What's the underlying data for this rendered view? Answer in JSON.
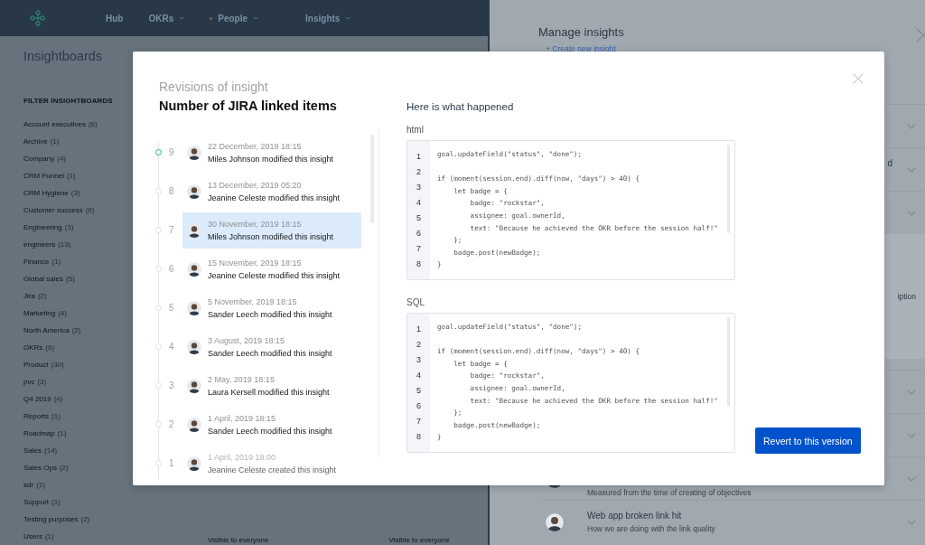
{
  "nav": {
    "items": [
      {
        "label": "Hub",
        "caret": false,
        "dot": false
      },
      {
        "label": "OKRs",
        "caret": true,
        "dot": false
      },
      {
        "label": "People",
        "caret": true,
        "dot": true
      },
      {
        "label": "Insights",
        "caret": true,
        "dot": false
      }
    ]
  },
  "sidebar": {
    "title": "Insightboards",
    "heading": "FILTER INSIGHTBOARDS",
    "items": [
      {
        "label": "Account executives",
        "count": "(6)"
      },
      {
        "label": "Archive",
        "count": "(1)"
      },
      {
        "label": "Company",
        "count": "(4)"
      },
      {
        "label": "CRM Funnel",
        "count": "(1)"
      },
      {
        "label": "CRM Hygiene",
        "count": "(3)"
      },
      {
        "label": "Customer success",
        "count": "(6)"
      },
      {
        "label": "Engineering",
        "count": "(3)"
      },
      {
        "label": "engineers",
        "count": "(13)"
      },
      {
        "label": "Finance",
        "count": "(1)"
      },
      {
        "label": "Global sales",
        "count": "(5)"
      },
      {
        "label": "Jira",
        "count": "(2)"
      },
      {
        "label": "Marketing",
        "count": "(4)"
      },
      {
        "label": "North America",
        "count": "(2)"
      },
      {
        "label": "OKRs",
        "count": "(6)"
      },
      {
        "label": "Product",
        "count": "(30)"
      },
      {
        "label": "pvc",
        "count": "(3)"
      },
      {
        "label": "Q4 2019",
        "count": "(4)"
      },
      {
        "label": "Reports",
        "count": "(1)"
      },
      {
        "label": "Roadmap",
        "count": "(1)"
      },
      {
        "label": "Sales",
        "count": "(14)"
      },
      {
        "label": "Sales Ops",
        "count": "(2)"
      },
      {
        "label": "sdr",
        "count": "(1)"
      },
      {
        "label": "Support",
        "count": "(1)"
      },
      {
        "label": "Testing purposes",
        "count": "(2)"
      },
      {
        "label": "Users",
        "count": "(1)"
      }
    ]
  },
  "boards": [
    {
      "visibility": "Visible to everyone"
    },
    {
      "visibility": "Visible to everyone"
    }
  ],
  "drawer": {
    "title": "Manage insights",
    "link": "+ Create new insight",
    "rows": [
      {
        "kind": "row"
      },
      {
        "kind": "row",
        "title": "d"
      },
      {
        "kind": "row"
      },
      {
        "kind": "card",
        "text": "iption"
      },
      {
        "kind": "row"
      },
      {
        "kind": "row"
      },
      {
        "kind": "row",
        "avatar": true,
        "subtitle": "Measured from the time of creating of objectives"
      },
      {
        "kind": "row",
        "avatar": true,
        "title": "Web app broken link hit",
        "subtitle": "How we are doing with the link quality"
      }
    ]
  },
  "modal": {
    "subtitle": "Revisions of insight",
    "title": "Number of JIRA linked items",
    "heading": "Here is what happened",
    "revisions": [
      {
        "number": "9",
        "date": "22 December, 2019 18:15",
        "text": "Miles Johnson modified this insight",
        "current": true,
        "selected": false
      },
      {
        "number": "8",
        "date": "13 December, 2019 05:20",
        "text": "Jeanine Celeste modified this insight",
        "current": false,
        "selected": false
      },
      {
        "number": "7",
        "date": "30 November, 2019 18:15",
        "text": "Miles Johnson modified this insight",
        "current": false,
        "selected": true
      },
      {
        "number": "6",
        "date": "15 November, 2019 18:15",
        "text": "Jeanine Celeste modified this insight",
        "current": false,
        "selected": false
      },
      {
        "number": "5",
        "date": "5 November, 2019 18:15",
        "text": "Sander Leech modified this insight",
        "current": false,
        "selected": false
      },
      {
        "number": "4",
        "date": "3 August, 2019 18:15",
        "text": "Sander Leech modified this insight",
        "current": false,
        "selected": false
      },
      {
        "number": "3",
        "date": "2 May, 2019 18:15",
        "text": "Laura Kersell modified this insight",
        "current": false,
        "selected": false
      },
      {
        "number": "2",
        "date": "1 April, 2019 18:15",
        "text": "Sander Leech modified this insight",
        "current": false,
        "selected": false
      },
      {
        "number": "1",
        "date": "1 April, 2019 18:00",
        "text": "Jeanine Celeste created this insight",
        "current": false,
        "selected": false
      }
    ],
    "code_blocks": [
      {
        "label": "html",
        "line_numbers": [
          "1",
          "2",
          "3",
          "4",
          "5",
          "6",
          "7",
          "8"
        ],
        "lines": [
          {
            "kind": "code",
            "text": "goal.updateField(\"status\", \"done\");"
          },
          {
            "kind": "blank"
          },
          {
            "kind": "code",
            "text": "if (moment(session.end).diff(now, \"days\") > 40) {"
          },
          {
            "kind": "code",
            "text": "    let badge = {"
          },
          {
            "kind": "code",
            "text": "        badge: \"rockstar\","
          },
          {
            "kind": "code",
            "text": "        assignee: goal.ownerId,"
          },
          {
            "kind": "code",
            "text": "        text: \"Because he achieved the OKR before the session half!\""
          },
          {
            "kind": "code",
            "text": "    };"
          },
          {
            "kind": "code",
            "text": "    badge.post(newBadge);"
          },
          {
            "kind": "code",
            "text": "}"
          }
        ]
      },
      {
        "label": "SQL",
        "line_numbers": [
          "1",
          "2",
          "3",
          "4",
          "5",
          "6",
          "7",
          "8"
        ],
        "lines": [
          {
            "kind": "code",
            "text": "goal.updateField(\"status\", \"done\");"
          },
          {
            "kind": "blank"
          },
          {
            "kind": "code",
            "text": "if (moment(session.end).diff(now, \"days\") > 40) {"
          },
          {
            "kind": "code",
            "text": "    let badge = {"
          },
          {
            "kind": "code",
            "text": "        badge: \"rockstar\","
          },
          {
            "kind": "code",
            "text": "        assignee: goal.ownerId,"
          },
          {
            "kind": "code",
            "text": "        text: \"Because he achieved the OKR before the session half!\""
          },
          {
            "kind": "code",
            "text": "    };"
          },
          {
            "kind": "code",
            "text": "    badge.post(newBadge);"
          },
          {
            "kind": "code",
            "text": "}"
          }
        ]
      }
    ],
    "button": "Revert to this version"
  }
}
